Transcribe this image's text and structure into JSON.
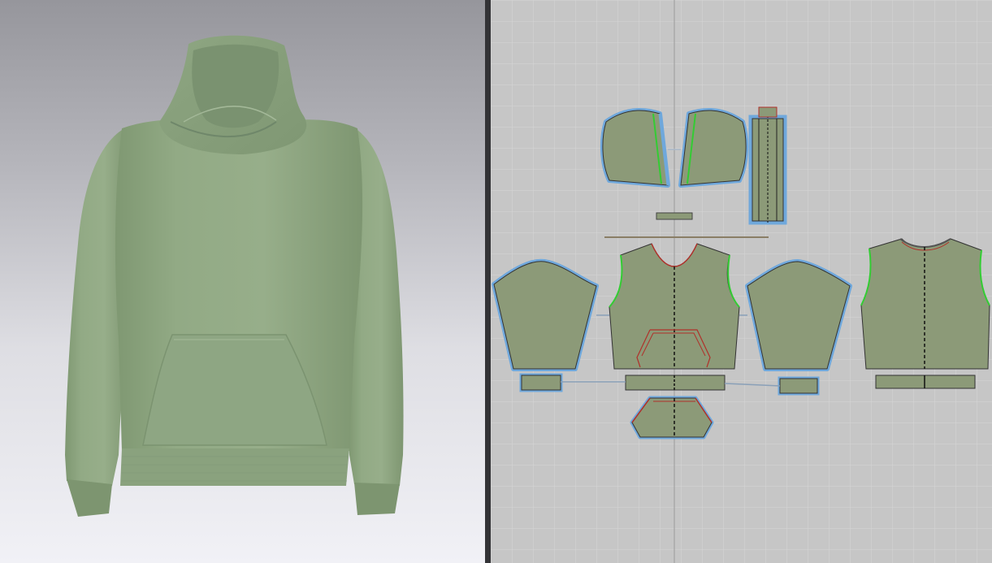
{
  "app": {
    "viewports": {
      "avatar_3d": {
        "garment": "hoodie",
        "garment_color": "#8fa882"
      },
      "pattern_2d": {
        "grid": true
      }
    }
  },
  "colors": {
    "fabric": "#8c9a78",
    "piece_outline_selected": "#6fa8dc",
    "seam_green": "#33cc33",
    "seam_red": "#b0302a",
    "grid_bg": "#c6c6c6",
    "grid_line": "#d6d6d6",
    "divider": "#333336"
  },
  "pieces": [
    {
      "name": "hood-left"
    },
    {
      "name": "hood-right"
    },
    {
      "name": "placket"
    },
    {
      "name": "hood-tab"
    },
    {
      "name": "drawcord"
    },
    {
      "name": "sleeve-left"
    },
    {
      "name": "front-body"
    },
    {
      "name": "sleeve-right"
    },
    {
      "name": "back-body"
    },
    {
      "name": "cuff-left"
    },
    {
      "name": "front-hem-rib"
    },
    {
      "name": "cuff-right"
    },
    {
      "name": "back-hem-rib"
    },
    {
      "name": "kangaroo-pocket"
    }
  ]
}
